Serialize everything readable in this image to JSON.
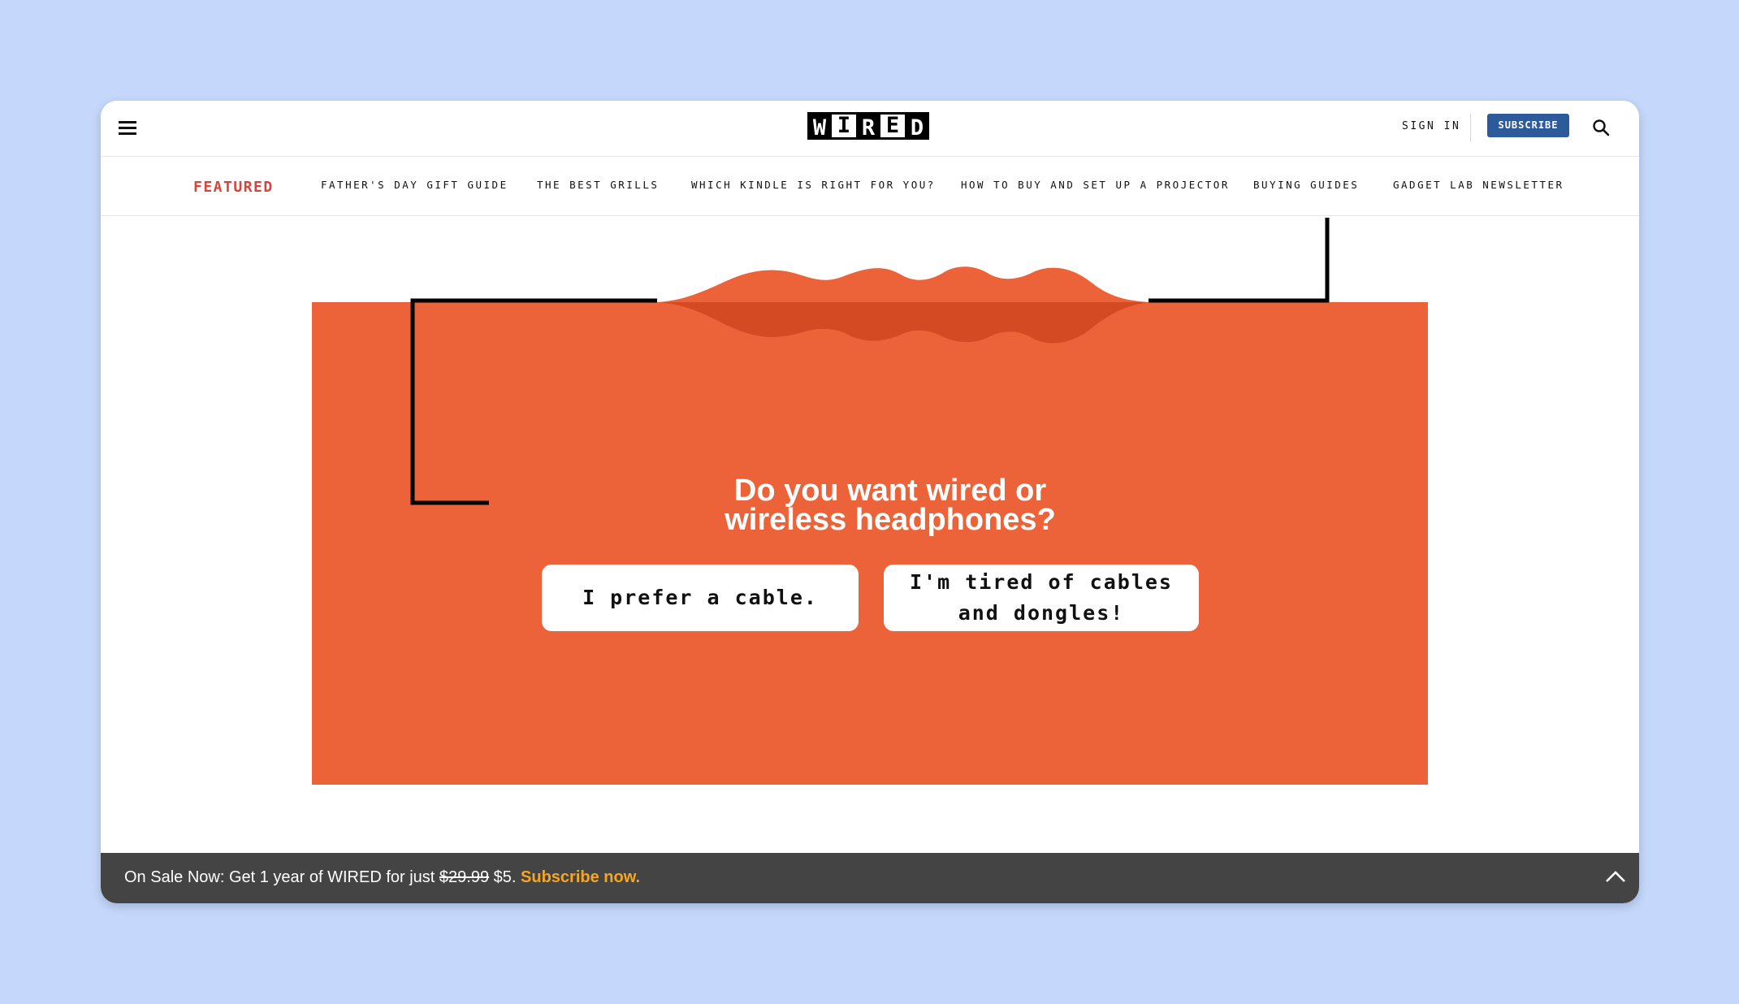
{
  "header": {
    "logo_letters": [
      "W",
      "I",
      "R",
      "E",
      "D"
    ],
    "sign_in": "SIGN IN",
    "subscribe": "SUBSCRIBE"
  },
  "nav": {
    "featured": "FEATURED",
    "items": [
      "FATHER'S DAY GIFT GUIDE",
      "THE BEST GRILLS",
      "WHICH KINDLE IS RIGHT FOR YOU?",
      "HOW TO BUY AND SET UP A PROJECTOR",
      "BUYING GUIDES",
      "GADGET LAB NEWSLETTER"
    ]
  },
  "quiz": {
    "question": "Do you want wired or wireless headphones?",
    "answers": [
      "I prefer a cable.",
      "I'm tired of cables and dongles!"
    ]
  },
  "banner": {
    "text": "On Sale Now: Get 1 year of WIRED for just",
    "old_price": "$29.99",
    "new_price": "$5.",
    "cta": "Subscribe now."
  },
  "colors": {
    "page_background": "#c5d8fb",
    "accent_orange": "#ec6239",
    "wave_dark": "#d44a22",
    "featured_red": "#d9443a",
    "subscribe_blue": "#2d5a9b",
    "banner_dark": "#444444",
    "cta_gold": "#f5a623"
  }
}
